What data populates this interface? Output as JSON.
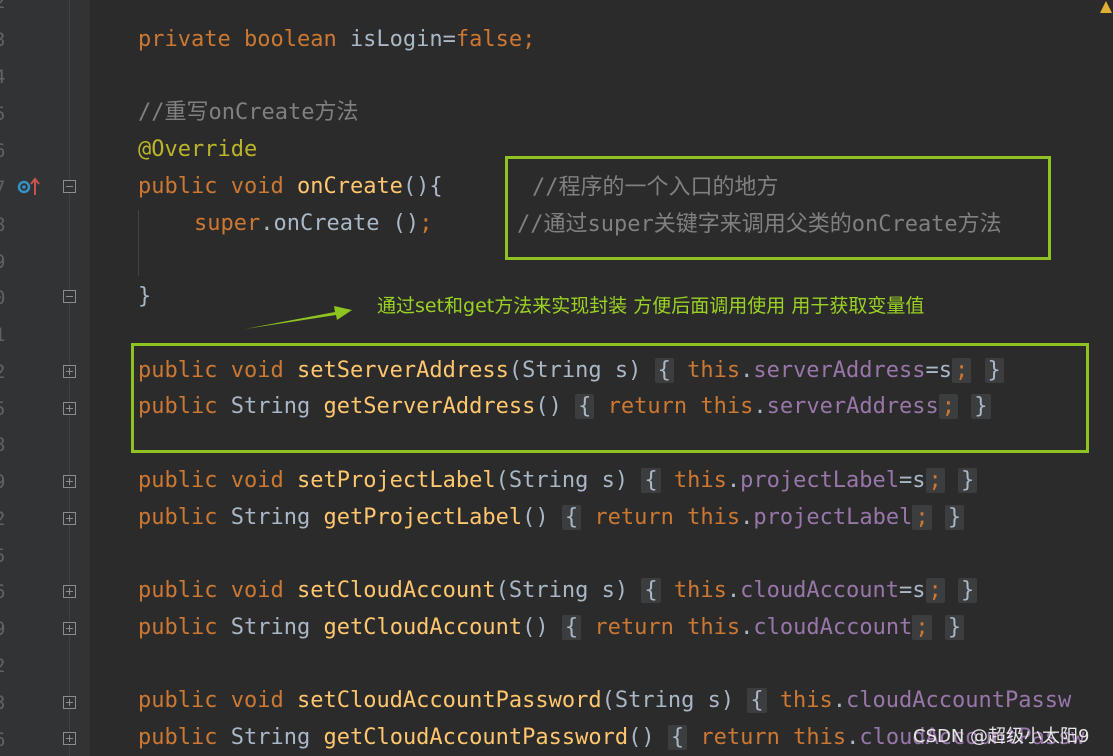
{
  "gutter": {
    "line_numbers": [
      "2",
      "3",
      "4",
      "5",
      "6",
      "7",
      "8",
      "9",
      "0",
      "1",
      "2",
      "5",
      "8",
      "9",
      "2",
      "5",
      "6",
      "9",
      "2",
      "3",
      "6"
    ]
  },
  "code": {
    "line_is_login": {
      "kw1": "private",
      "kw2": "boolean",
      "name": "isLogin",
      "op": "=",
      "val": "false",
      "end": ";"
    },
    "line_comment": "//重写onCreate方法",
    "line_override": "@Override",
    "line_oncreate": {
      "kw1": "public",
      "kw2": "void",
      "fn": "onCreate",
      "rest": "(){"
    },
    "line_super": {
      "kw": "super",
      "rest1": ".onCreate ()",
      "end": ";"
    },
    "line_close": "}",
    "methods": [
      {
        "id": "set-server-address",
        "p1": "public",
        "p2": "void",
        "fn": "setServerAddress",
        "args": "(String s)",
        "body_kw": "this",
        "dot": ".",
        "field": "serverAddress",
        "tail": "=s",
        "semi": ";"
      },
      {
        "id": "get-server-address",
        "p1": "public",
        "p2": "String",
        "fn": "getServerAddress",
        "args": "()",
        "ret": "return",
        "body_kw": "this",
        "dot": ".",
        "field": "serverAddress",
        "tail": "",
        "semi": ";"
      },
      {
        "id": "set-project-label",
        "p1": "public",
        "p2": "void",
        "fn": "setProjectLabel",
        "args": "(String s)",
        "body_kw": "this",
        "dot": ".",
        "field": "projectLabel",
        "tail": "=s",
        "semi": ";"
      },
      {
        "id": "get-project-label",
        "p1": "public",
        "p2": "String",
        "fn": "getProjectLabel",
        "args": "()",
        "ret": "return",
        "body_kw": "this",
        "dot": ".",
        "field": "projectLabel",
        "tail": "",
        "semi": ";"
      },
      {
        "id": "set-cloud-account",
        "p1": "public",
        "p2": "void",
        "fn": "setCloudAccount",
        "args": "(String s)",
        "body_kw": "this",
        "dot": ".",
        "field": "cloudAccount",
        "tail": "=s",
        "semi": ";"
      },
      {
        "id": "get-cloud-account",
        "p1": "public",
        "p2": "String",
        "fn": "getCloudAccount",
        "args": "()",
        "ret": "return",
        "body_kw": "this",
        "dot": ".",
        "field": "cloudAccount",
        "tail": "",
        "semi": ";"
      },
      {
        "id": "set-cloud-account-password",
        "p1": "public",
        "p2": "void",
        "fn": "setCloudAccountPassword",
        "args": "(String s)",
        "body_kw": "this",
        "dot": ".",
        "field": "cloudAccountPassw",
        "tail": "",
        "semi": ""
      },
      {
        "id": "get-cloud-account-password",
        "p1": "public",
        "p2": "String",
        "fn": "getCloudAccountPassword",
        "args": "()",
        "ret": "return",
        "body_kw": "this",
        "dot": ".",
        "field": "cloudAccountPassw",
        "tail": "",
        "semi": ""
      }
    ],
    "brace_open": "{",
    "brace_close": "}"
  },
  "annotations": {
    "comment_line1": "//程序的一个入口的地方",
    "comment_line2": "//通过super关键字来调用父类的onCreate方法",
    "encapsulation_note": "通过set和get方法来实现封装 方便后面调用使用 用于获取变量值"
  },
  "watermark": "CSDN @超级小太阳9",
  "colors": {
    "keyword": "#cc7832",
    "function": "#ffc66d",
    "field": "#9876aa",
    "comment": "#808080",
    "annotation": "#bbb529",
    "highlight_box": "#8fc31f",
    "background": "#2b2b2b",
    "gutter": "#313335"
  },
  "icons": {
    "override": "override-up-arrow-icon",
    "warning": "warning-icon"
  }
}
